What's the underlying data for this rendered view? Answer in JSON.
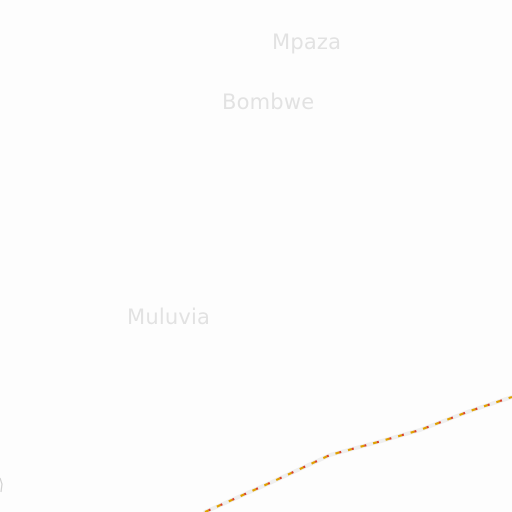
{
  "map": {
    "background_color": "#fdfdfd",
    "places": [
      {
        "name": "Mpaza"
      },
      {
        "name": "Bombwe"
      },
      {
        "name": "Muluvia"
      }
    ],
    "boundary": {
      "kind": "dashed-boundary-line",
      "casing_color": "#f3f3f3",
      "dash_color_primary": "#e0a000",
      "dash_color_secondary": "#d8402a"
    }
  }
}
